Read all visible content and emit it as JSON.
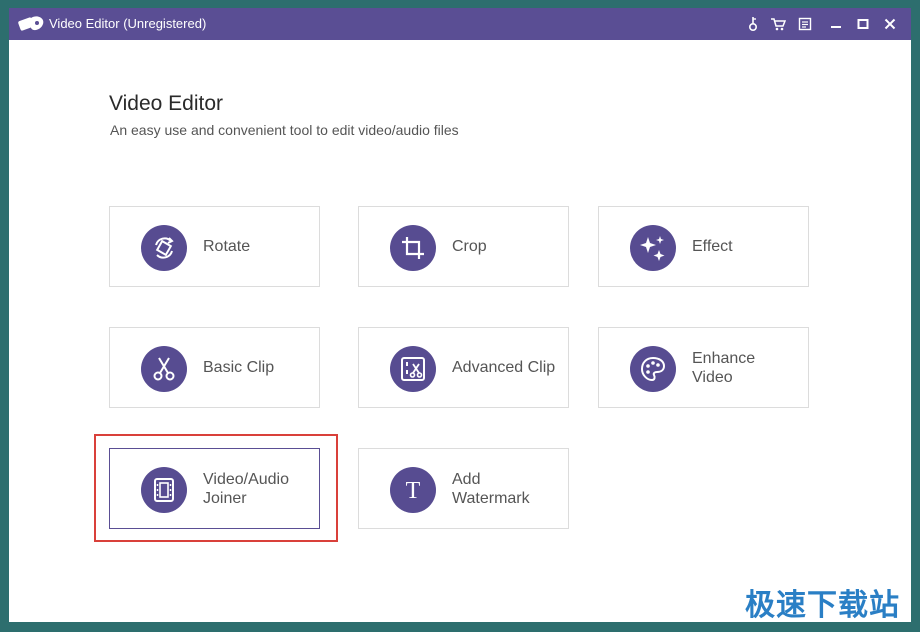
{
  "window": {
    "title": "Video Editor (Unregistered)",
    "accent_color": "#5a4e94",
    "controls": [
      "key-icon",
      "cart-icon",
      "feedback-icon",
      "minimize-icon",
      "maximize-icon",
      "close-icon"
    ]
  },
  "main": {
    "heading": "Video Editor",
    "subheading": "An easy use and convenient tool to edit video/audio files"
  },
  "tools": [
    {
      "label": "Rotate",
      "icon": "rotate-icon"
    },
    {
      "label": "Crop",
      "icon": "crop-icon"
    },
    {
      "label": "Effect",
      "icon": "sparkle-icon"
    },
    {
      "label": "Basic Clip",
      "icon": "scissors-icon"
    },
    {
      "label": "Advanced Clip",
      "icon": "advanced-clip-icon"
    },
    {
      "label": "Enhance\nVideo",
      "icon": "palette-icon"
    },
    {
      "label": "Video/Audio\nJoiner",
      "icon": "film-joiner-icon",
      "selected": true
    },
    {
      "label": "Add\nWatermark",
      "icon": "text-t-icon"
    }
  ],
  "watermark_text": "极速下载站"
}
